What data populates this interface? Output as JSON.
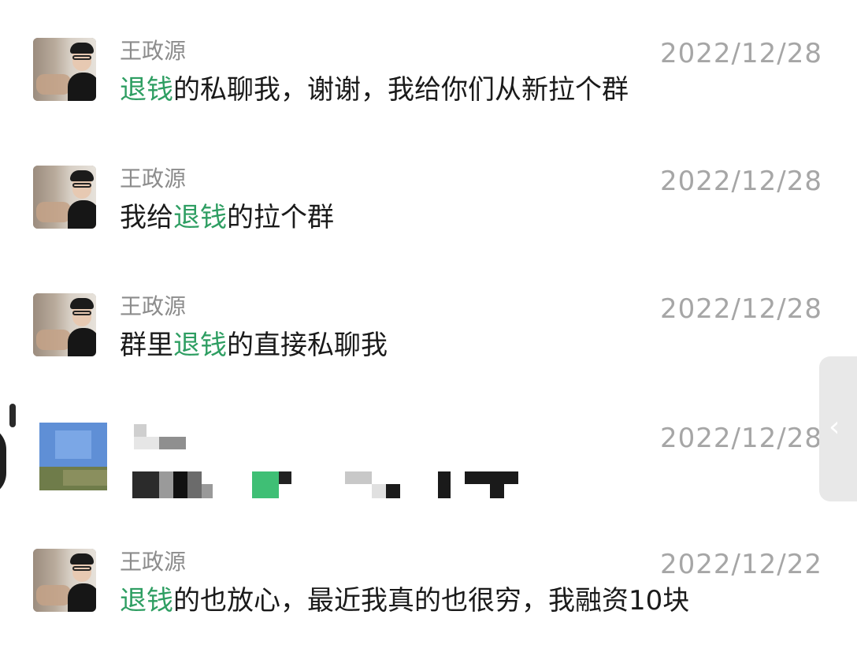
{
  "messages": [
    {
      "name": "王政源",
      "date": "2022/12/28",
      "text_highlight": "退钱",
      "text_rest": "的私聊我，谢谢，我给你们从新拉个群"
    },
    {
      "name": "王政源",
      "date": "2022/12/28",
      "text_prefix": "我给",
      "text_highlight": "退钱",
      "text_rest": "的拉个群"
    },
    {
      "name": "王政源",
      "date": "2022/12/28",
      "text_prefix": "群里",
      "text_highlight": "退钱",
      "text_rest": "的直接私聊我"
    },
    {
      "name": "",
      "date": "2022/12/28",
      "text": ""
    },
    {
      "name": "王政源",
      "date": "2022/12/22",
      "text_highlight": "退钱",
      "text_rest": "的也放心，最近我真的也很穷，我融资10块"
    }
  ],
  "icons": {
    "side_handle": "chevron-left-icon"
  },
  "colors": {
    "highlight": "#2e9e62",
    "name": "#8c8c8c",
    "date": "#a6a6a6",
    "text": "#1a1a1a"
  }
}
